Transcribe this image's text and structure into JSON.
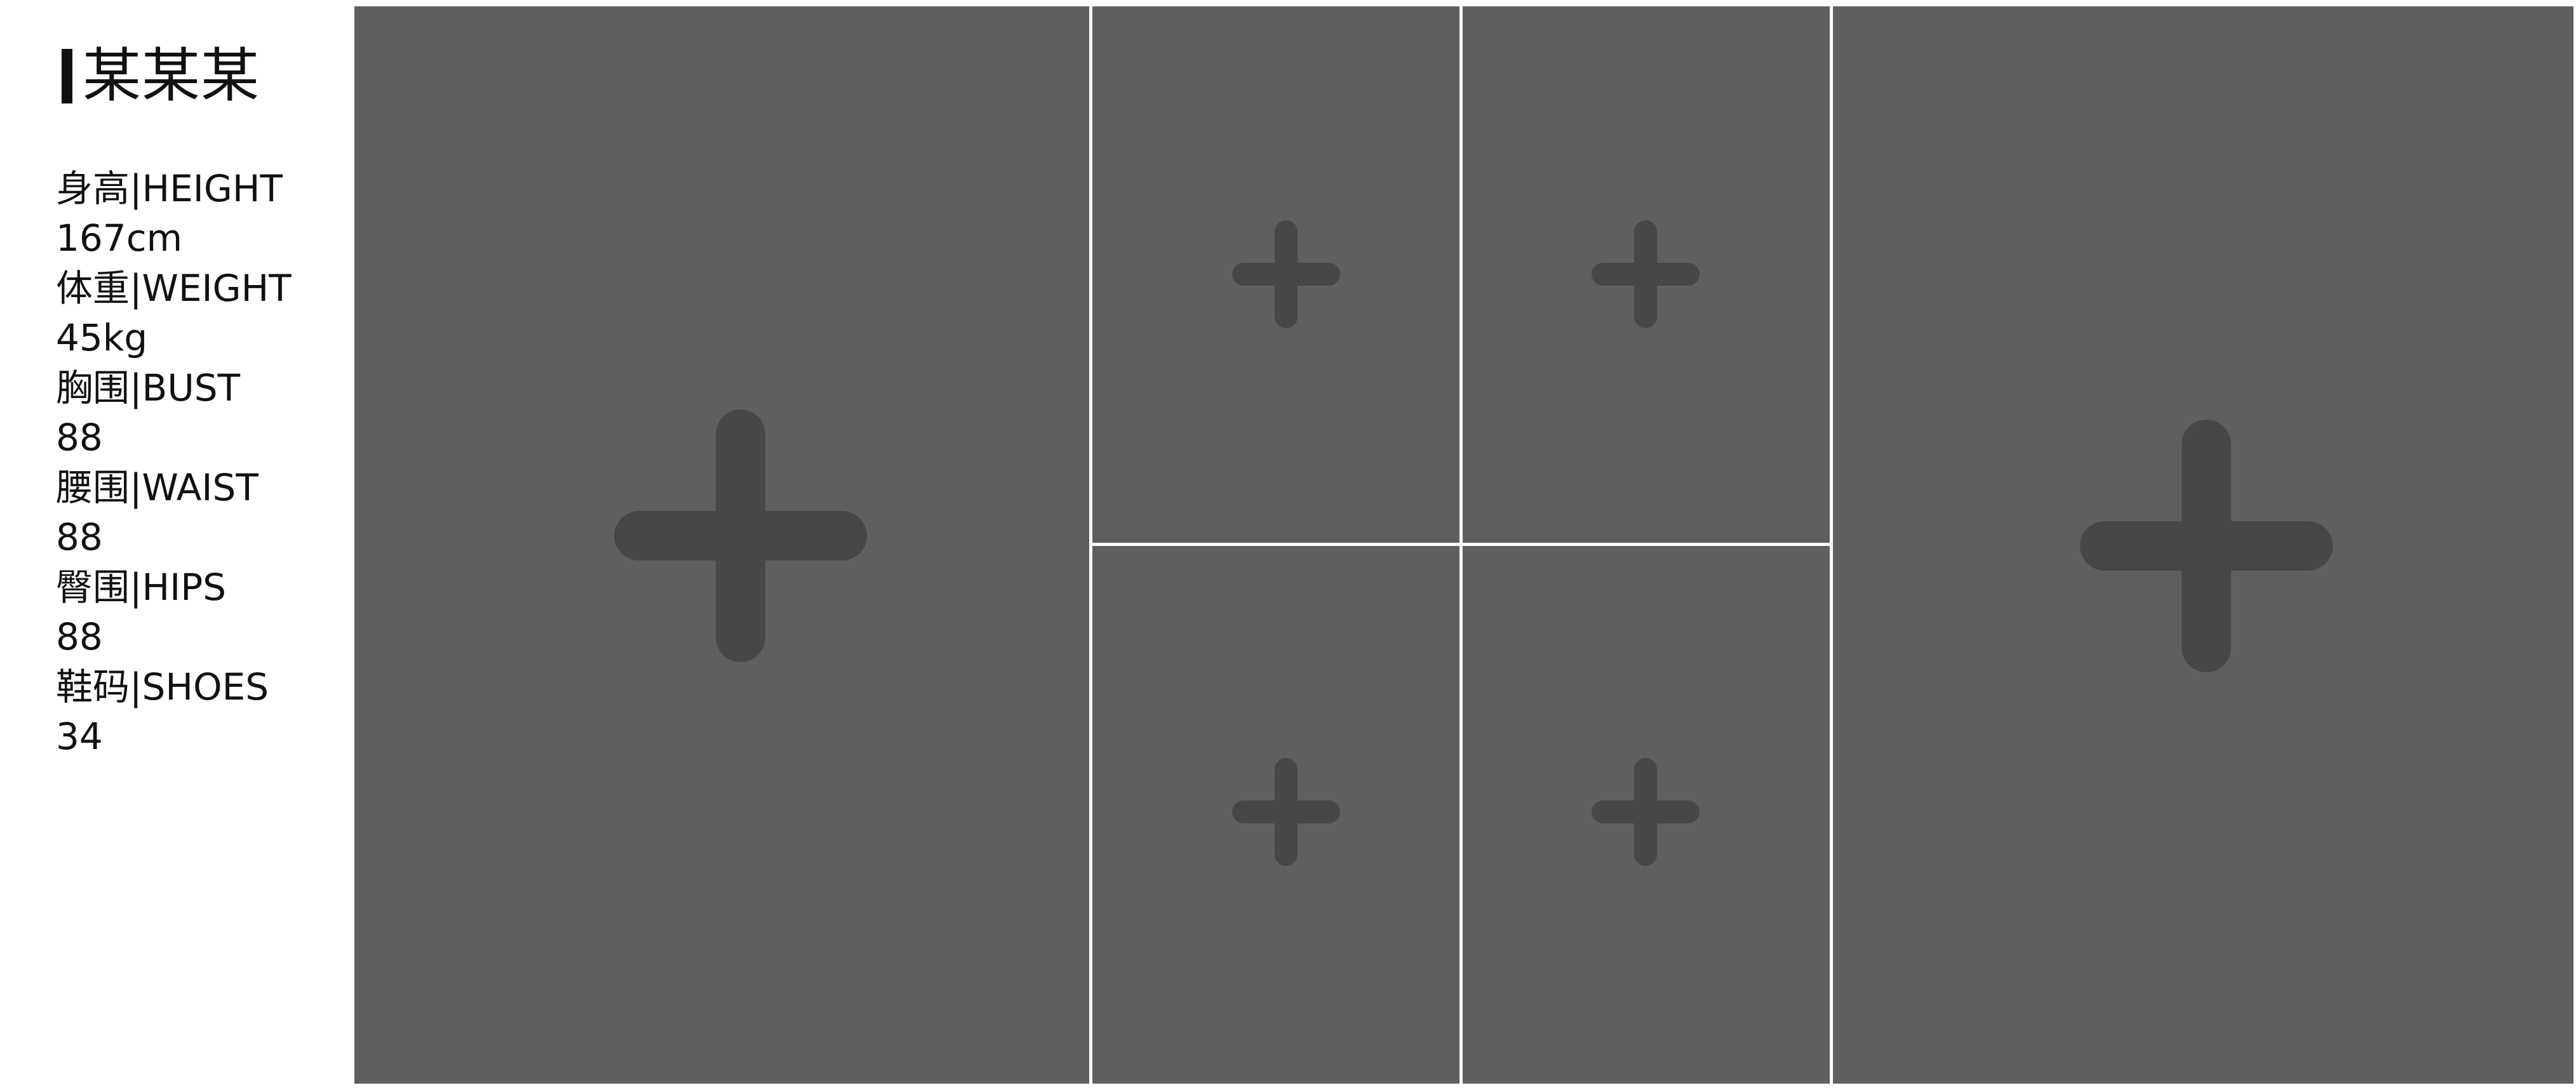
{
  "profile": {
    "name": "某某某",
    "stats": [
      {
        "label": "身高|HEIGHT",
        "value": "167cm"
      },
      {
        "label": "体重|WEIGHT",
        "value": "45kg"
      },
      {
        "label": "胸围|BUST",
        "value": "88"
      },
      {
        "label": "腰围|WAIST",
        "value": "88"
      },
      {
        "label": "臀围|HIPS",
        "value": "88"
      },
      {
        "label": "鞋码|SHOES",
        "value": "34"
      }
    ]
  },
  "photo_slots": {
    "icon": "plus-icon",
    "colors": {
      "slot_background": "#5f5f5f",
      "plus": "#474747",
      "divider": "#ffffff"
    }
  }
}
